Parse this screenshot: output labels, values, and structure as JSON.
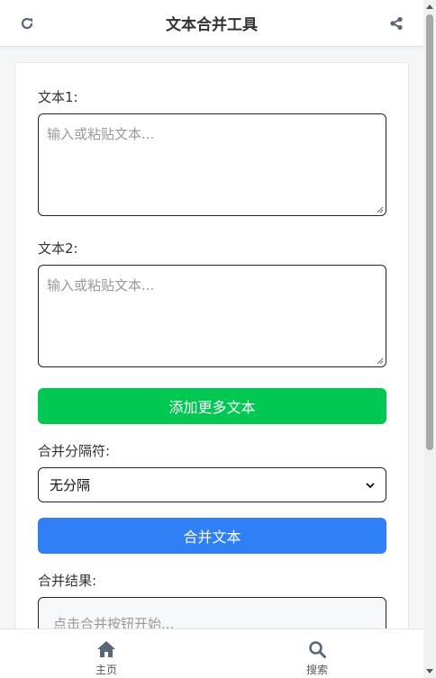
{
  "header": {
    "title": "文本合并工具",
    "refresh_icon": "refresh-icon",
    "share_icon": "share-icon"
  },
  "form": {
    "text1_label": "文本1:",
    "text1_placeholder": "输入或粘贴文本...",
    "text1_value": "",
    "text2_label": "文本2:",
    "text2_placeholder": "输入或粘贴文本...",
    "text2_value": "",
    "add_more_label": "添加更多文本",
    "separator_label": "合并分隔符:",
    "separator_selected": "无分隔",
    "merge_label": "合并文本",
    "result_label": "合并结果:",
    "result_placeholder": "点击合并按钮开始..."
  },
  "colors": {
    "green": "#00c853",
    "blue": "#2f7ff6"
  },
  "bottom_nav": {
    "home_label": "主页",
    "search_label": "搜索"
  }
}
